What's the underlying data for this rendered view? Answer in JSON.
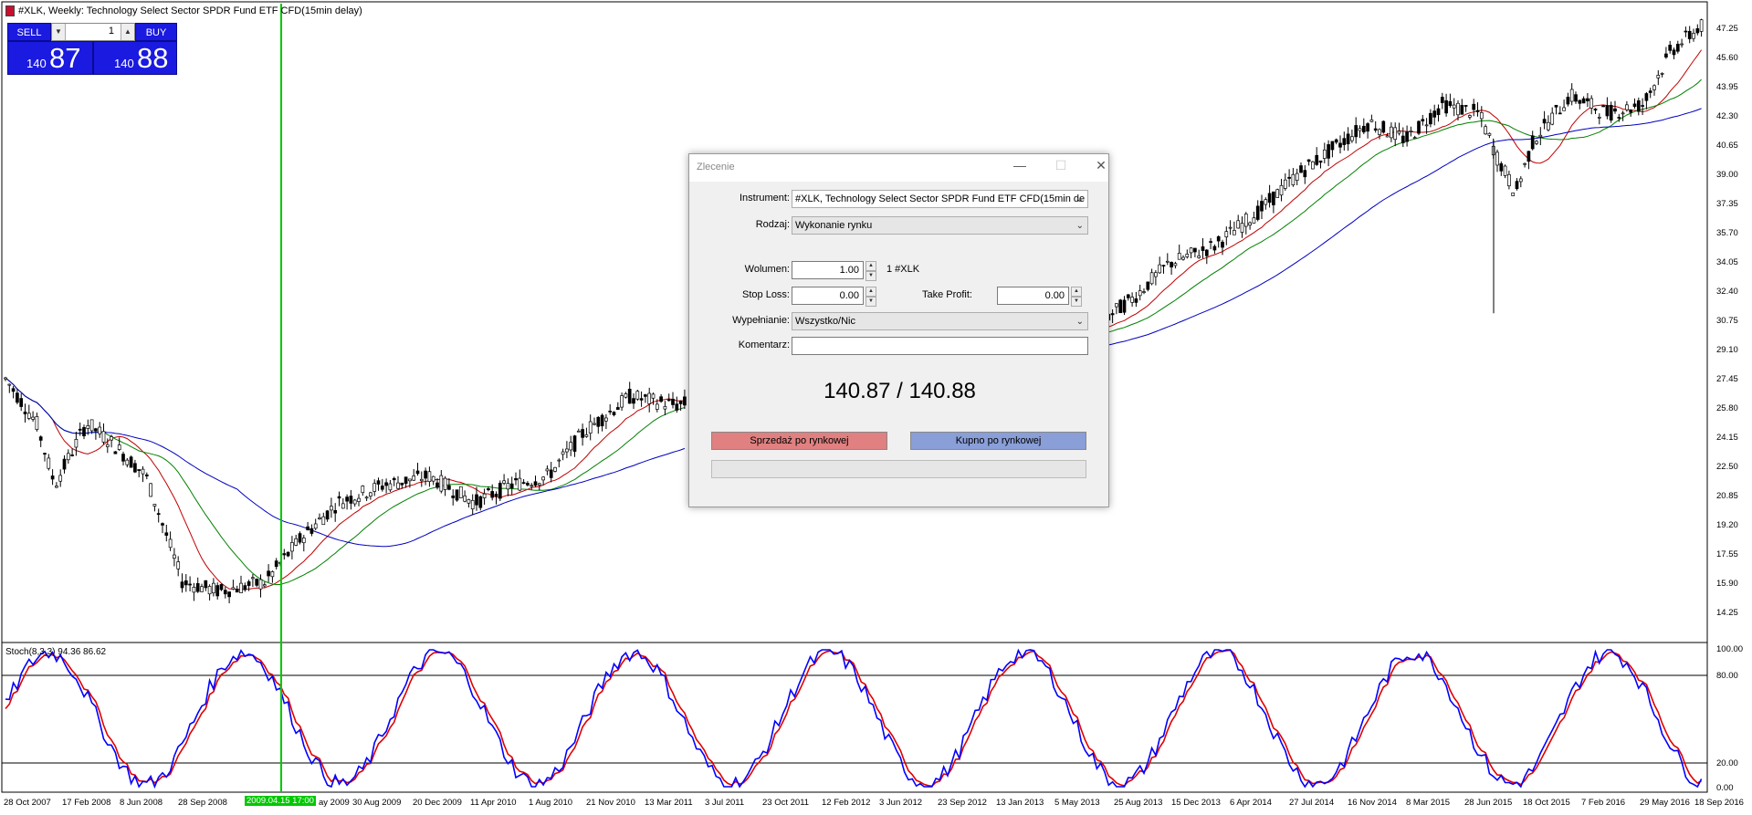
{
  "chart": {
    "title": "#XLK, Weekly:  Technology Select Sector SPDR Fund ETF CFD(15min delay)",
    "price_axis": [
      "47.25",
      "45.60",
      "43.95",
      "42.30",
      "40.65",
      "39.00",
      "37.35",
      "35.70",
      "34.05",
      "32.40",
      "30.75",
      "29.10",
      "27.45",
      "25.80",
      "24.15",
      "22.50",
      "20.85",
      "19.20",
      "17.55",
      "15.90",
      "14.25"
    ],
    "stoch_axis": [
      "100.00",
      "80.00",
      "20.00",
      "0.00"
    ],
    "stoch_label": "Stoch(8,3,3) 94.36 86.62",
    "time_axis": [
      "28 Oct 2007",
      "17 Feb 2008",
      "8 Jun 2008",
      "28 Sep 2008",
      "ay 2009",
      "30 Aug 2009",
      "20 Dec 2009",
      "11 Apr 2010",
      "1 Aug 2010",
      "21 Nov 2010",
      "13 Mar 2011",
      "3 Jul 2011",
      "23 Oct 2011",
      "12 Feb 2012",
      "3 Jun 2012",
      "23 Sep 2012",
      "13 Jan 2013",
      "5 May 2013",
      "25 Aug 2013",
      "15 Dec 2013",
      "6 Apr 2014",
      "27 Jul 2014",
      "16 Nov 2014",
      "8 Mar 2015",
      "28 Jun 2015",
      "18 Oct 2015",
      "7 Feb 2016",
      "29 May 2016",
      "18 Sep 2016"
    ],
    "cursor_time": "2009.04.15 17:00",
    "colors": {
      "ma_fast": "#c00000",
      "ma_mid": "#008000",
      "ma_slow": "#0000c0",
      "stoch_main": "#0000ff",
      "stoch_signal": "#e00000",
      "cursor": "#00c800"
    }
  },
  "trade_panel": {
    "sell_label": "SELL",
    "buy_label": "BUY",
    "lot": "1",
    "sell_small": "140",
    "sell_big": "87",
    "buy_small": "140",
    "buy_big": "88"
  },
  "dialog": {
    "title": "Zlecenie",
    "instrument_label": "Instrument:",
    "instrument_value": "#XLK, Technology Select Sector SPDR Fund ETF CFD(15min de",
    "type_label": "Rodzaj:",
    "type_value": "Wykonanie rynku",
    "volume_label": "Wolumen:",
    "volume_value": "1.00",
    "volume_unit": "1 #XLK",
    "sl_label": "Stop Loss:",
    "sl_value": "0.00",
    "tp_label": "Take Profit:",
    "tp_value": "0.00",
    "fill_label": "Wypełnianie:",
    "fill_value": "Wszystko/Nic",
    "comment_label": "Komentarz:",
    "comment_value": "",
    "price_text": "140.87 / 140.88",
    "sell_button": "Sprzedaż po rynkowej",
    "buy_button": "Kupno po rynkowej"
  }
}
